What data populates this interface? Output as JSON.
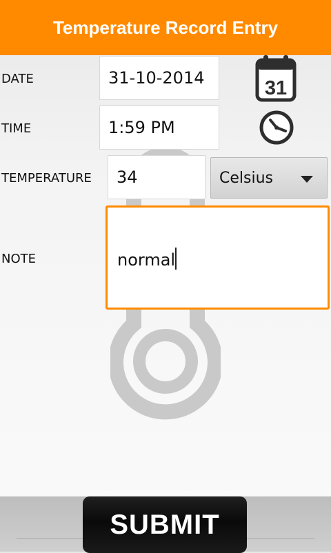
{
  "header": {
    "title": "Temperature Record Entry"
  },
  "form": {
    "date": {
      "label": "DATE",
      "value": "31-10-2014"
    },
    "time": {
      "label": "TIME",
      "value": "1:59 PM"
    },
    "temperature": {
      "label": "TEMPERATURE",
      "value": "34",
      "unit": "Celsius"
    },
    "note": {
      "label": "NOTE",
      "value": "normal"
    }
  },
  "icons": {
    "calendar": {
      "name": "calendar-icon",
      "text": "31"
    },
    "clock": {
      "name": "clock-icon"
    }
  },
  "submit_label": "SUBMIT",
  "colors": {
    "accent": "#ff8a00",
    "background": "#f3f3f3",
    "button": "#111111"
  }
}
